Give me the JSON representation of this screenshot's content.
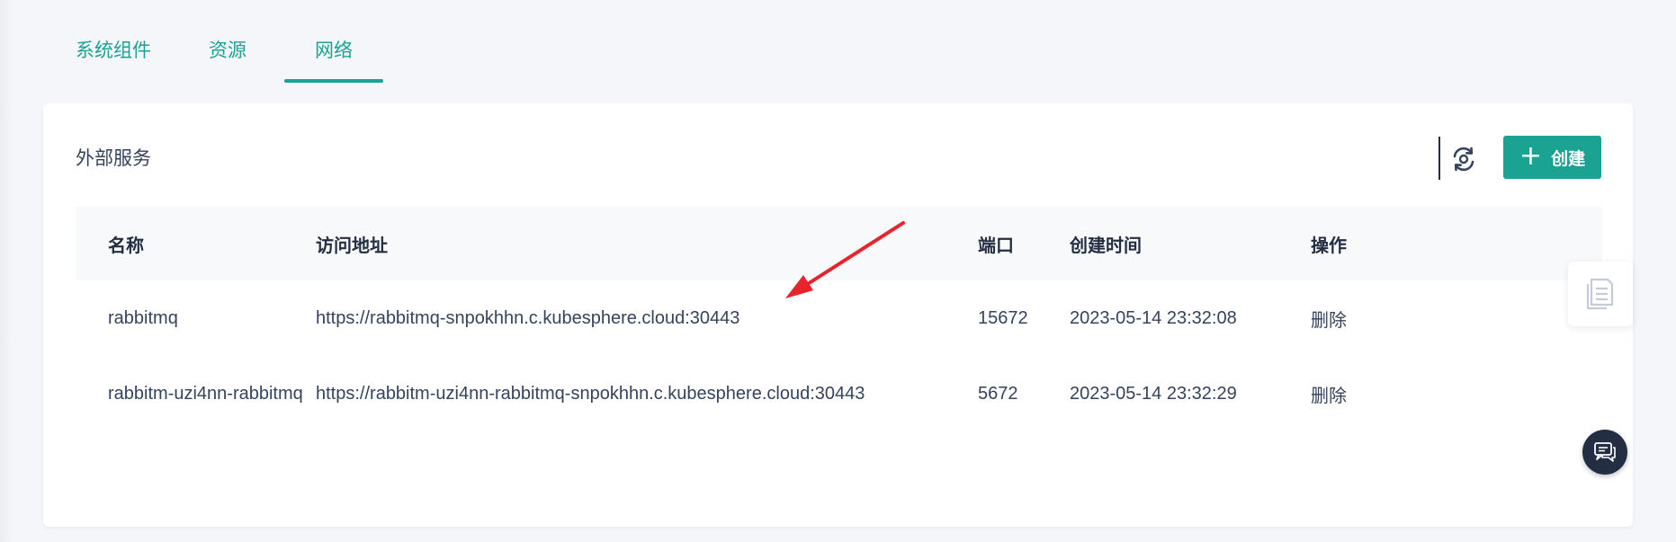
{
  "tabs": [
    {
      "label": "系统组件",
      "active": false
    },
    {
      "label": "资源",
      "active": false
    },
    {
      "label": "网络",
      "active": true
    }
  ],
  "section": {
    "title": "外部服务",
    "create_label": "创建"
  },
  "table": {
    "headers": [
      "名称",
      "访问地址",
      "端口",
      "创建时间",
      "操作"
    ],
    "rows": [
      {
        "name": "rabbitmq",
        "url": "https://rabbitmq-snpokhhn.c.kubesphere.cloud:30443",
        "port": "15672",
        "created": "2023-05-14 23:32:08",
        "action": "删除"
      },
      {
        "name": "rabbitm-uzi4nn-rabbitmq",
        "url": "https://rabbitm-uzi4nn-rabbitmq-snpokhhn.c.kubesphere.cloud:30443",
        "port": "5672",
        "created": "2023-05-14 23:32:29",
        "action": "删除"
      }
    ]
  },
  "icons": {
    "refresh": "refresh-icon",
    "plus": "plus-icon",
    "document": "document-copy-icon",
    "chat": "chat-icon",
    "annotation": "red-arrow-annotation"
  },
  "colors": {
    "accent": "#1aa393",
    "annotation_red": "#e8242b",
    "text_dark": "#242e42"
  }
}
